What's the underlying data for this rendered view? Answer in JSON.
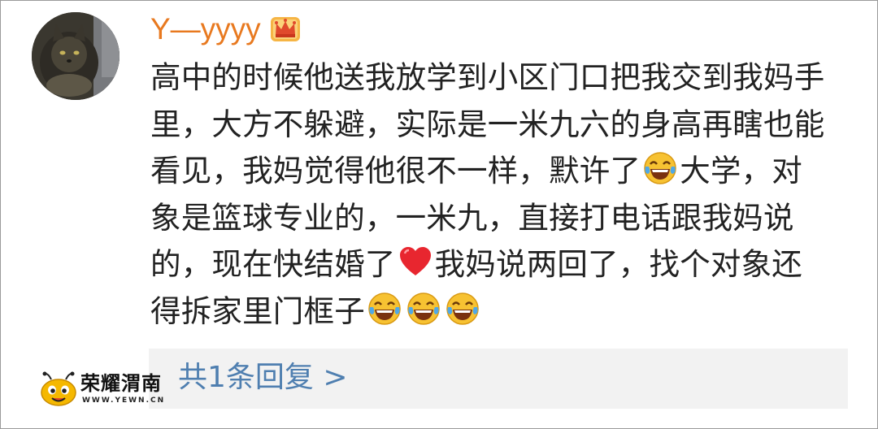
{
  "comment": {
    "username": "Y—yyyy",
    "user_badge_icon": "crown-icon",
    "avatar_icon": "cat-avatar",
    "content_lines": [
      "高中的时候他送我放学到小区门口把我交到我妈手",
      "里，大方不躲避，实际是一米九六的身高再瞎也能",
      "看见，我妈觉得他很不一样，默许了",
      "大学，对",
      "象是篮球专业的，一米九，直接打电话跟我妈说",
      "的，现在快结婚了",
      "我妈说两回了，找个对象还",
      "得拆家里门框子"
    ],
    "emoji": {
      "laugh": "laugh-cry-emoji",
      "heart": "red-heart-emoji"
    }
  },
  "replies": {
    "label": "共1条回复 >"
  },
  "watermark": {
    "name": "荣耀渭南",
    "url": "WWW.YEWN.CN"
  },
  "colors": {
    "username": "#e8791f",
    "reply_link": "#4f7fb0",
    "reply_bg": "#f2f2f2",
    "text": "#222222"
  }
}
